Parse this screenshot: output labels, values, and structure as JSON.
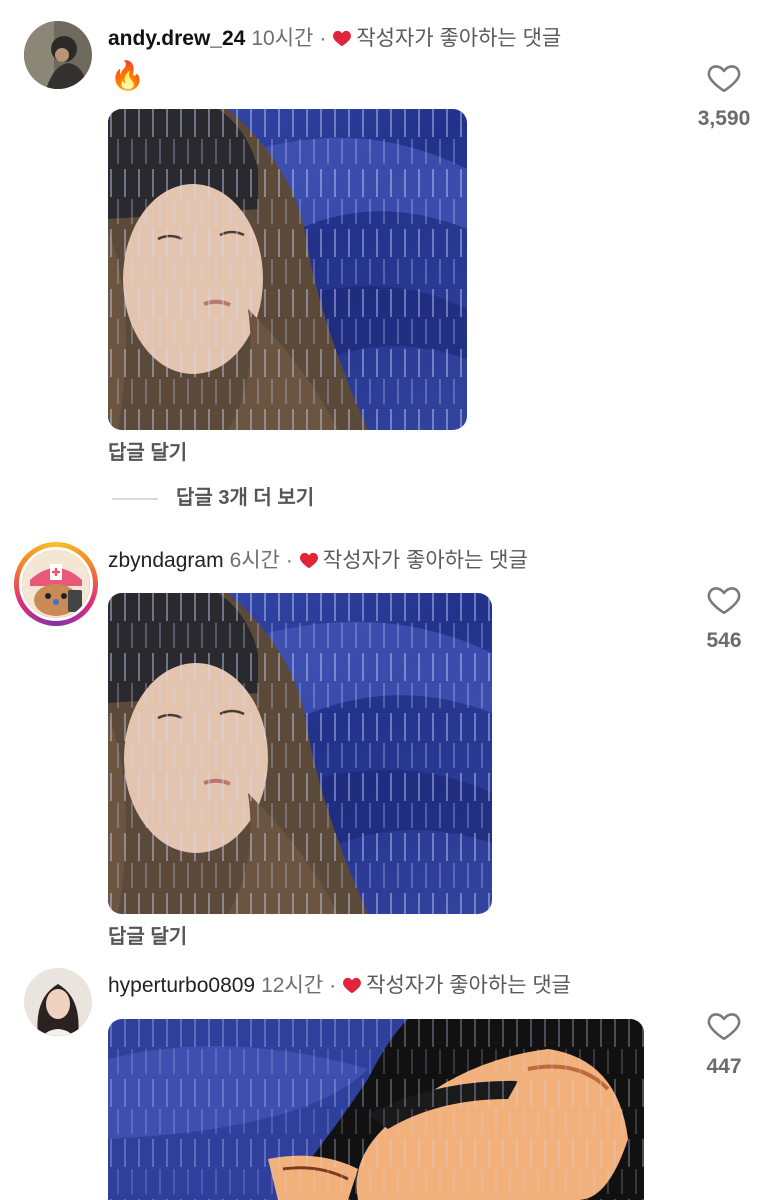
{
  "comments": [
    {
      "username": "andy.drew_24",
      "time": "10시간",
      "liked_by_author": "작성자가 좋아하는 댓글",
      "text": "🔥",
      "reply_label": "답글 달기",
      "view_replies": "답글 3개 더 보기",
      "like_count": "3,590"
    },
    {
      "username": "zbyndagram",
      "time": "6시간",
      "liked_by_author": "작성자가 좋아하는 댓글",
      "reply_label": "답글 달기",
      "like_count": "546"
    },
    {
      "username": "hyperturbo0809",
      "time": "12시간",
      "liked_by_author": "작성자가 좋아하는 댓글",
      "like_count": "447"
    }
  ],
  "colors": {
    "author_heart": "#e0243a",
    "rain_blue": "#2f3f9e",
    "meta_gray": "#6f6f6f"
  },
  "icons": [
    "heart-outline-icon",
    "heart-filled-icon"
  ]
}
